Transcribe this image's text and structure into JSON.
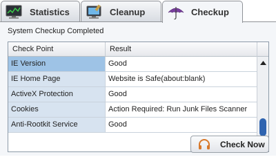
{
  "tabs": [
    {
      "label": "Statistics",
      "icon": "monitor-chart-icon",
      "active": false
    },
    {
      "label": "Cleanup",
      "icon": "brush-monitor-icon",
      "active": false
    },
    {
      "label": "Checkup",
      "icon": "umbrella-icon",
      "active": true
    }
  ],
  "main": {
    "heading": "System Checkup Completed",
    "table": {
      "columns": [
        "Check Point",
        "Result"
      ],
      "rows": [
        {
          "check_point": "IE Version",
          "result": "Good"
        },
        {
          "check_point": "IE Home Page",
          "result": "Website is Safe(about:blank)"
        },
        {
          "check_point": "ActiveX Protection",
          "result": "Good"
        },
        {
          "check_point": "Cookies",
          "result": "Action Required: Run Junk Files Scanner"
        },
        {
          "check_point": "Anti-Rootkit Service",
          "result": "Good"
        }
      ],
      "selected_row": 0
    },
    "check_button": {
      "label": "Check Now",
      "icon": "headphones-icon"
    }
  },
  "colors": {
    "accent": "#2f64b0",
    "selected_row": "#9ec3e6",
    "row_tint": "#d7e3f0"
  }
}
